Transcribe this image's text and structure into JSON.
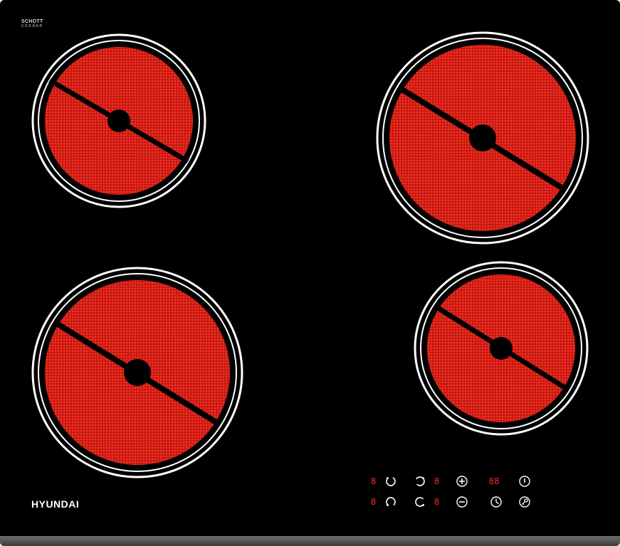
{
  "brand": {
    "logo_line1": "SCHOTT",
    "logo_line2": "CERAN®",
    "name": "HYUNDAI"
  },
  "colors": {
    "glass": "#000000",
    "heater": "#d8201a",
    "ring": "#ffffff",
    "display": "#ff2a1a",
    "symbol": "#ffffff"
  },
  "zones": [
    {
      "id": "top-left",
      "size": "small"
    },
    {
      "id": "top-right",
      "size": "large"
    },
    {
      "id": "bottom-left",
      "size": "large"
    },
    {
      "id": "bottom-right",
      "size": "small"
    }
  ],
  "controls": {
    "displays": {
      "zone_tl": "8",
      "zone_bl": "8",
      "zone_tr": "8",
      "zone_br": "8",
      "timer": "88"
    },
    "icons": [
      {
        "name": "zone-top-left-select-icon"
      },
      {
        "name": "zone-bottom-left-select-icon"
      },
      {
        "name": "zone-top-right-select-icon"
      },
      {
        "name": "zone-bottom-right-select-icon"
      },
      {
        "name": "plus-icon"
      },
      {
        "name": "minus-icon"
      },
      {
        "name": "power-icon"
      },
      {
        "name": "timer-clock-icon"
      },
      {
        "name": "lock-key-icon"
      }
    ]
  }
}
